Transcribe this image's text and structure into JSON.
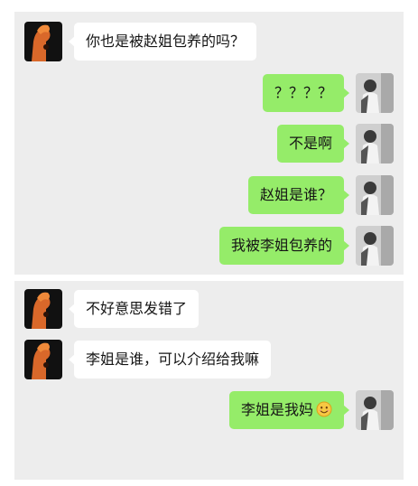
{
  "chat": {
    "panel_1": {
      "m1": {
        "text": "你也是被赵姐包养的吗？",
        "side": "left"
      },
      "m2": {
        "text": "？？？？",
        "side": "right"
      },
      "m3": {
        "text": "不是啊",
        "side": "right"
      },
      "m4": {
        "text": "赵姐是谁？",
        "side": "right"
      },
      "m5": {
        "text": "我被李姐包养的",
        "side": "right"
      }
    },
    "panel_2": {
      "m1": {
        "text": "不好意思发错了",
        "side": "left"
      },
      "m2": {
        "text": "李姐是谁，可以介绍给我嘛",
        "side": "left"
      },
      "m3": {
        "text": "李姐是我妈",
        "side": "right",
        "emoji": "smiling-face-emoji"
      }
    }
  },
  "colors": {
    "panel_bg": "#ededed",
    "incoming_bubble": "#ffffff",
    "outgoing_bubble": "#95ec69",
    "text": "#151515"
  },
  "icons": {
    "contact_avatar": "orange-figure-avatar",
    "self_avatar": "grayscale-person-avatar"
  }
}
